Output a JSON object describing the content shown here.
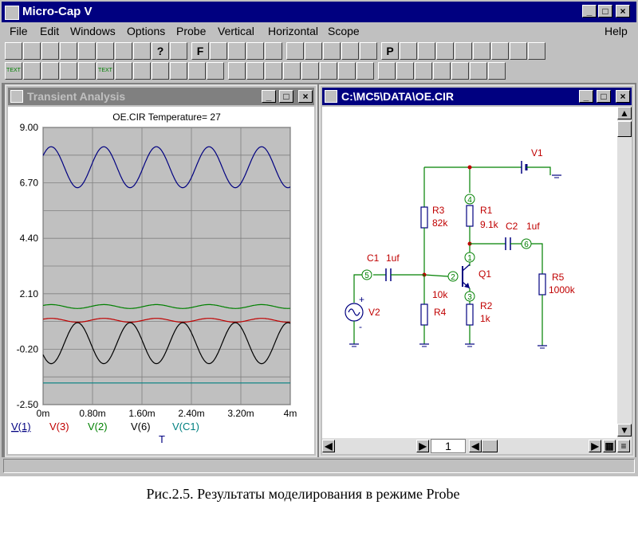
{
  "app": {
    "title": "Micro-Cap V",
    "menu": [
      "File",
      "Edit",
      "Windows",
      "Options",
      "Probe",
      "Vertical",
      "Horizontal",
      "Scope"
    ],
    "help": "Help"
  },
  "toolbar1": [
    "arrow",
    "pencil",
    "line",
    "wave",
    "box",
    "select",
    "zoom",
    "grid",
    "?",
    "diag",
    "F",
    "loop",
    "dual",
    "frame",
    "tilt",
    "win1",
    "win2",
    "win3",
    "win4",
    "calc",
    "P",
    "zoom-in",
    "zoom-out",
    "square",
    "wave2",
    "scope",
    "list",
    "VID",
    "bars"
  ],
  "toolbar2": [
    "TEXT",
    "wave",
    "node",
    "nodebox",
    "line",
    "TEXT",
    "cross",
    "dots",
    "rect",
    "window",
    "diag",
    "shape",
    "box",
    "box2",
    "wire",
    "dots2",
    "peak",
    "valley",
    "peak2",
    "x",
    "y",
    "right",
    "flag",
    "play",
    "stop",
    "pause",
    "step"
  ],
  "transient": {
    "title": "Transient Analysis",
    "chart_title": "OE.CIR Temperature= 27",
    "x_title": "T"
  },
  "chart_data": {
    "type": "line",
    "title": "OE.CIR Temperature= 27",
    "xlabel": "T",
    "xlim": [
      0,
      4
    ],
    "ylim": [
      -2.5,
      9.0
    ],
    "x_ticks": [
      "0m",
      "0.80m",
      "1.60m",
      "2.40m",
      "3.20m",
      "4m"
    ],
    "y_ticks": [
      "9.00",
      "6.70",
      "4.40",
      "2.10",
      "-0.20",
      "-2.50"
    ],
    "grid": true,
    "background": "#c0c0c0",
    "series": [
      {
        "name": "V(1)",
        "color": "#000080",
        "offset": 7.35,
        "amp": 0.85,
        "periods": 4.7,
        "phase": 0.6
      },
      {
        "name": "V(3)",
        "color": "#c00000",
        "offset": 1.0,
        "amp": 0.08,
        "periods": 4.7,
        "phase": 0.6
      },
      {
        "name": "V(2)",
        "color": "#008000",
        "offset": 1.57,
        "amp": 0.08,
        "periods": 4.7,
        "phase": 0.6
      },
      {
        "name": "V(6)",
        "color": "#000000",
        "offset": 0.05,
        "amp": 0.85,
        "periods": 4.7,
        "phase": 3.74
      },
      {
        "name": "V(C1)",
        "color": "#008080",
        "offset": -1.6,
        "amp": 0.0,
        "periods": 4.7,
        "phase": 0.0
      }
    ]
  },
  "schematic": {
    "title": "C:\\MC5\\DATA\\OE.CIR",
    "page": "1",
    "labels": {
      "V1": "V1",
      "R3": "R3",
      "R3v": "82k",
      "R1": "R1",
      "R1v": "9.1k",
      "C2": "C2",
      "C2v": "1uf",
      "C1": "C1",
      "C1v": "1uf",
      "Q1": "Q1",
      "R4v": "10k",
      "R4": "R4",
      "R2": "R2",
      "R2v": "1k",
      "R5": "R5",
      "R5v": "1000k",
      "V2": "V2",
      "n1": "1",
      "n2": "2",
      "n3": "3",
      "n4": "4",
      "n5": "5",
      "n6": "6",
      "plus": "+",
      "minus": "-"
    },
    "colors": {
      "wire": "#008000",
      "part": "#000080",
      "text": "#c00000",
      "node": "#008000"
    }
  },
  "caption": "Рис.2.5. Результаты моделирования в режиме Probe"
}
